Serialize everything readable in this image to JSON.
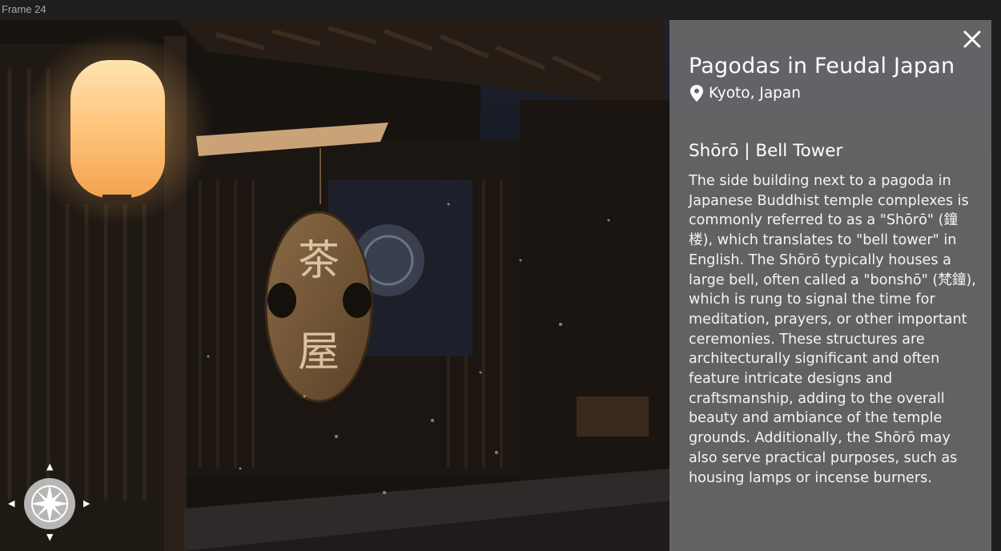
{
  "frame": {
    "label": "Frame 24"
  },
  "panel": {
    "title": "Pagodas in Feudal Japan",
    "location": "Kyoto, Japan",
    "subtitle": "Shōrō | Bell Tower",
    "body": "The side building next to a pagoda in Japanese Buddhist temple complexes is commonly referred to as a \"Shōrō\" (鐘楼), which translates to \"bell tower\" in English. The Shōrō typically houses a large bell, often called a \"bonshō\" (梵鐘), which is rung to signal the time for meditation, prayers, or other important ceremonies. These structures are architecturally significant and often feature intricate designs and craftsmanship, adding to the overall beauty and ambiance of the temple grounds. Additionally, the Shōrō may also serve practical purposes, such as housing lamps or incense burners."
  },
  "scene": {
    "sign_char_top": "茶",
    "sign_char_bottom": "屋"
  },
  "icons": {
    "close": "close-icon",
    "location": "map-pin-icon",
    "compass": "compass-icon",
    "nav_up": "▲",
    "nav_down": "▼",
    "nav_left": "◀",
    "nav_right": "▶"
  },
  "colors": {
    "panel_bg": "#68686a",
    "lantern_glow": "#ffb86a",
    "text": "#ffffff"
  }
}
